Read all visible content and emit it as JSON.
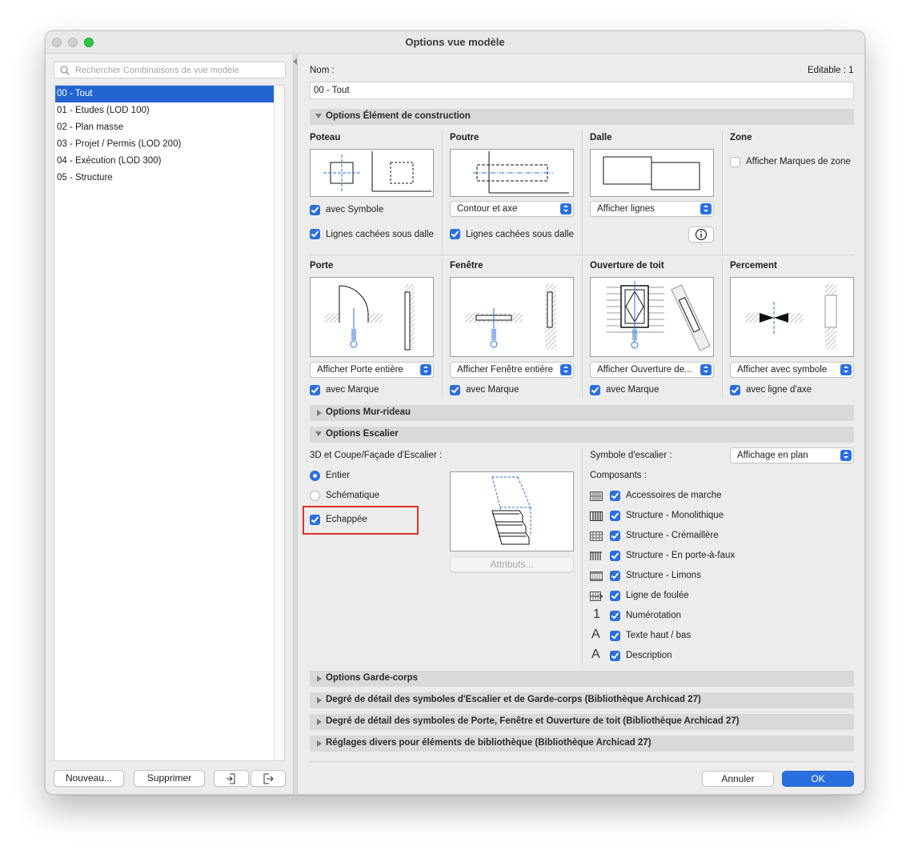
{
  "window": {
    "title": "Options vue modèle"
  },
  "sidebar": {
    "search_placeholder": "Rechercher Combinaisons de vue modèle",
    "items": [
      {
        "label": "00 - Tout"
      },
      {
        "label": "01 - Etudes (LOD 100)"
      },
      {
        "label": "02 - Plan masse"
      },
      {
        "label": "03 - Projet / Permis (LOD 200)"
      },
      {
        "label": "04 - Exécution (LOD 300)"
      },
      {
        "label": "05 - Structure"
      }
    ],
    "selected_index": 0,
    "new_label": "Nouveau...",
    "delete_label": "Supprimer",
    "import_icon": "import-icon",
    "export_icon": "export-icon"
  },
  "name": {
    "label": "Nom :",
    "value": "00 - Tout",
    "editable": "Editable : 1"
  },
  "sections": {
    "construction": "Options Élément de construction",
    "curtain_wall": "Options Mur-rideau",
    "stair": "Options Escalier",
    "railing": "Options Garde-corps",
    "detail_stair": "Degré de détail des symboles d'Escalier et de Garde-corps (Bibliothèque Archicad 27)",
    "detail_door": "Degré de détail des symboles de Porte, Fenêtre et Ouverture de toit (Bibliothèque Archicad 27)",
    "misc": "Réglages divers pour éléments de bibliothèque (Bibliothèque Archicad 27)"
  },
  "construction": {
    "poteau": {
      "title": "Poteau",
      "symbole": "avec Symbole",
      "cachees": "Lignes cachées sous dalle"
    },
    "poutre": {
      "title": "Poutre",
      "popup": "Contour et axe",
      "cachees": "Lignes cachées sous dalle"
    },
    "dalle": {
      "title": "Dalle",
      "popup": "Afficher lignes",
      "info_icon": "info-icon"
    },
    "zone": {
      "title": "Zone",
      "marques": "Afficher Marques de zone"
    },
    "porte": {
      "title": "Porte",
      "popup": "Afficher Porte entière",
      "marque": "avec Marque"
    },
    "fenetre": {
      "title": "Fenêtre",
      "popup": "Afficher Fenêtre entière",
      "marque": "avec Marque"
    },
    "ouverture": {
      "title": "Ouverture de toit",
      "popup": "Afficher Ouverture de...",
      "marque": "avec Marque"
    },
    "percement": {
      "title": "Percement",
      "popup": "Afficher avec symbole",
      "axe": "avec ligne d'axe"
    }
  },
  "stair": {
    "coupe_label": "3D et Coupe/Façade d'Escalier :",
    "entier": "Entier",
    "schematique": "Schématique",
    "echappee": "Echappée",
    "attributs": "Attributs...",
    "symbole_label": "Symbole d'escalier :",
    "symbole_popup": "Affichage en plan",
    "composants_label": "Composants :",
    "components": [
      {
        "label": "Accessoires de marche",
        "icon": "tread-accessories-icon"
      },
      {
        "label": "Structure - Monolithique",
        "icon": "monolithic-structure-icon"
      },
      {
        "label": "Structure - Crémaillère",
        "icon": "stringer-structure-icon"
      },
      {
        "label": "Structure - En porte-à-faux",
        "icon": "cantilever-structure-icon"
      },
      {
        "label": "Structure - Limons",
        "icon": "side-stringer-icon"
      },
      {
        "label": "Ligne de foulée",
        "icon": "walking-line-icon"
      },
      {
        "label": "Numérotation",
        "glyph": "1",
        "icon": "numbering-icon"
      },
      {
        "label": "Texte haut / bas",
        "glyph": "A",
        "icon": "text-icon"
      },
      {
        "label": "Description",
        "glyph": "A",
        "icon": "description-icon"
      }
    ]
  },
  "footer": {
    "cancel": "Annuler",
    "ok": "OK"
  },
  "colors": {
    "accent": "#2a6fe0",
    "selection": "#2264d1",
    "highlight": "#e0302a"
  }
}
